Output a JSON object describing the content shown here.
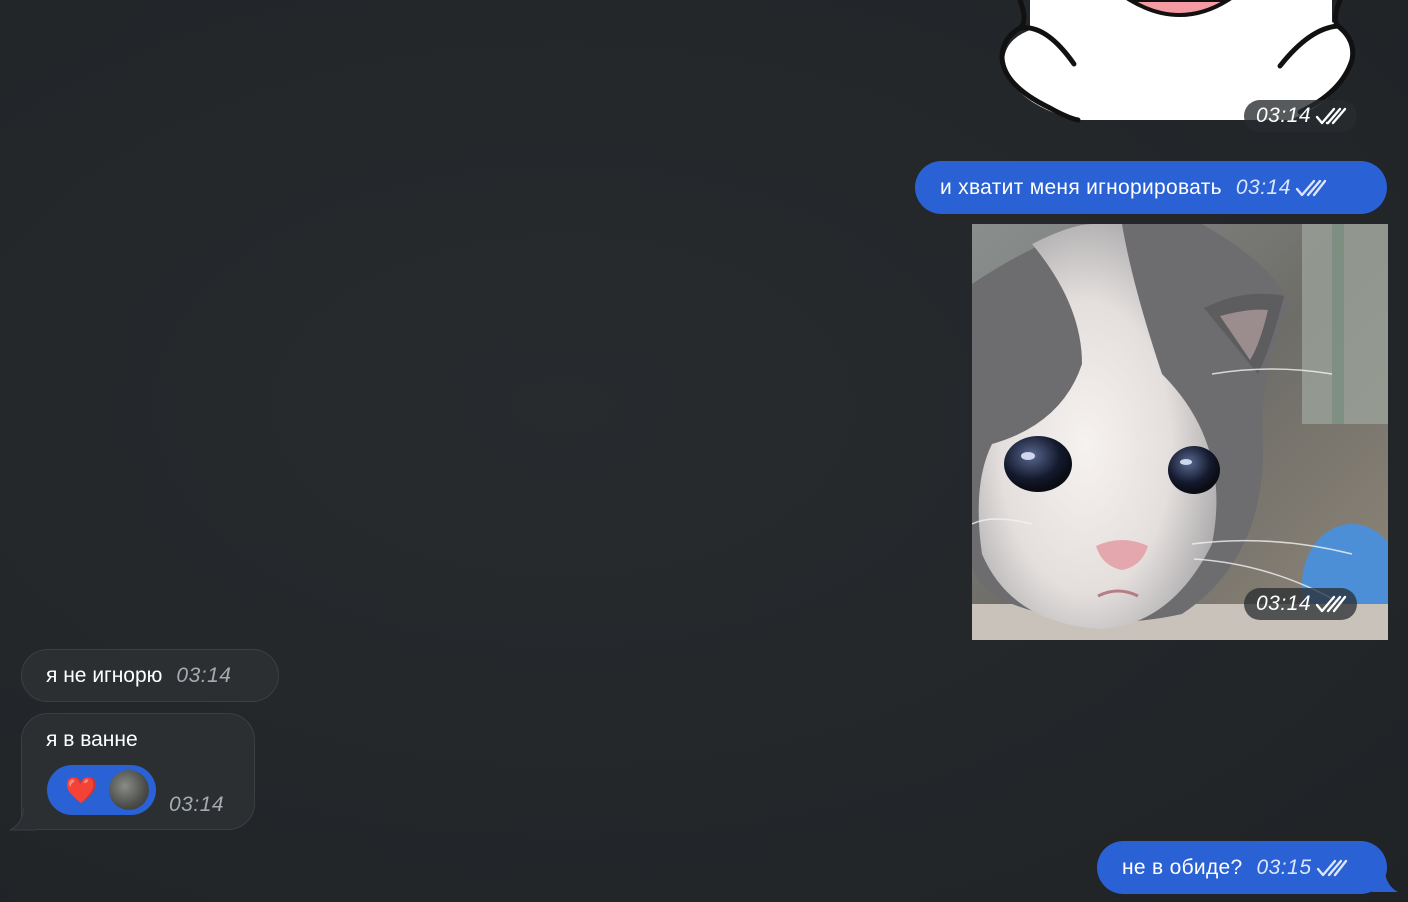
{
  "messages": {
    "sticker": {
      "time": "03:14",
      "status_icon": "double-check-icon"
    },
    "out1": {
      "text": "и хватит меня игнорировать",
      "time": "03:14",
      "status_icon": "double-check-icon"
    },
    "photo": {
      "time": "03:14",
      "status_icon": "double-check-icon"
    },
    "in1": {
      "text": "я не игнорю",
      "time": "03:14"
    },
    "in2": {
      "text": "я в ванне",
      "time": "03:14",
      "reaction": {
        "emoji": "❤️",
        "reactor_avatar": "avatar"
      }
    },
    "out2": {
      "text": "не в обиде?",
      "time": "03:15",
      "status_icon": "double-check-icon"
    }
  },
  "colors": {
    "background": "#23272a",
    "outgoing_bubble": "#2a61d4",
    "incoming_bubble": "#2b2f32",
    "reaction_pill": "#2a61d4"
  }
}
